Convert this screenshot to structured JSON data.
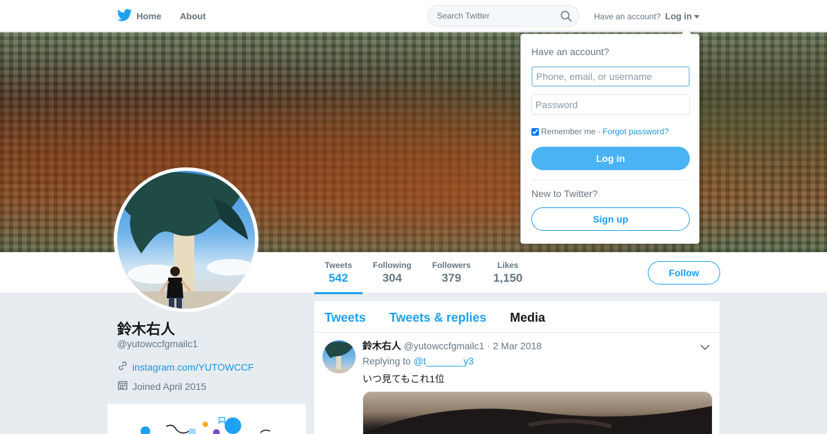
{
  "nav": {
    "home_label": "Home",
    "about_label": "About",
    "search_placeholder": "Search Twitter",
    "have_account": "Have an account?",
    "login_label": "Log in"
  },
  "profile": {
    "name": "鈴木右人",
    "handle": "@yutowccfgmailc1",
    "link": "instagram.com/YUTOWCCF",
    "joined": "Joined April 2015"
  },
  "stats": [
    {
      "label": "Tweets",
      "value": "542"
    },
    {
      "label": "Following",
      "value": "304"
    },
    {
      "label": "Followers",
      "value": "379"
    },
    {
      "label": "Likes",
      "value": "1,150"
    }
  ],
  "follow_label": "Follow",
  "tabs": [
    {
      "label": "Tweets"
    },
    {
      "label": "Tweets & replies"
    },
    {
      "label": "Media"
    }
  ],
  "tweet": {
    "name": "鈴木右人",
    "meta": "@yutowccfgmailc1 · 2 Mar 2018",
    "replying_prefix": "Replying to",
    "replying_to": "@t_______y3",
    "text": "いつ見てもこれ1位"
  },
  "login_dropdown": {
    "title": "Have an account?",
    "username_placeholder": "Phone, email, or username",
    "password_placeholder": "Password",
    "remember_label": "Remember me",
    "separator": "·",
    "forgot_label": "Forgot password?",
    "login_button": "Log in",
    "new_label": "New to Twitter?",
    "signup_button": "Sign up"
  },
  "colors": {
    "accent": "#1da1f2",
    "login_button_bg": "#4ab3f4",
    "page_bg": "#e6ecf0"
  }
}
